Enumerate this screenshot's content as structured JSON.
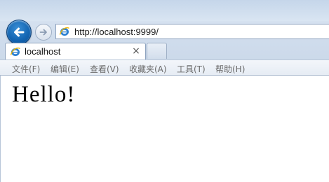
{
  "browser": {
    "address_url": "http://localhost:9999/",
    "tab_title": "localhost",
    "tab_close": "×",
    "icons": {
      "back": "back-arrow-icon",
      "forward": "forward-arrow-icon",
      "page": "ie-page-icon",
      "close": "close-icon"
    },
    "colors": {
      "back_button": "#1466b3",
      "chrome": "#d6e2f0",
      "menu_text": "#6b6b6b"
    }
  },
  "menu": {
    "file": "文件(F)",
    "edit": "编辑(E)",
    "view": "查看(V)",
    "favorites": "收藏夹(A)",
    "tools": "工具(T)",
    "help": "帮助(H)"
  },
  "page": {
    "heading": "Hello!"
  }
}
